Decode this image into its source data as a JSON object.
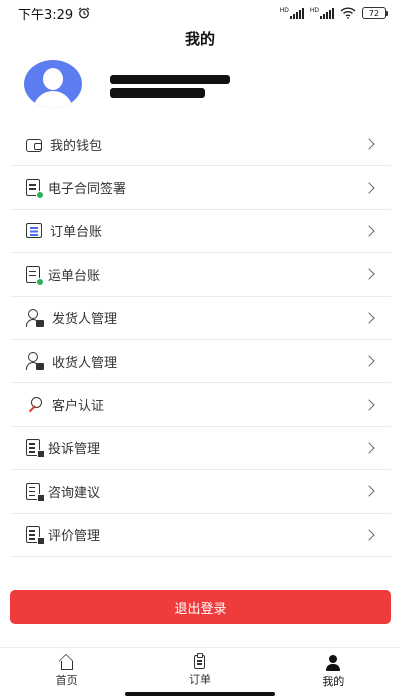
{
  "status_bar": {
    "time": "下午3:29",
    "battery": "72",
    "network_label": "HD"
  },
  "header": {
    "title": "我的"
  },
  "profile": {
    "name_redacted": true
  },
  "menu": {
    "items": [
      {
        "label": "我的钱包",
        "icon": "wallet-icon"
      },
      {
        "label": "电子合同签署",
        "icon": "contract-icon"
      },
      {
        "label": "订单台账",
        "icon": "order-ledger-icon"
      },
      {
        "label": "运单台账",
        "icon": "waybill-ledger-icon"
      },
      {
        "label": "发货人管理",
        "icon": "shipper-icon"
      },
      {
        "label": "收货人管理",
        "icon": "consignee-icon"
      },
      {
        "label": "客户认证",
        "icon": "certification-icon"
      },
      {
        "label": "投诉管理",
        "icon": "complaint-icon"
      },
      {
        "label": "咨询建议",
        "icon": "consult-icon"
      },
      {
        "label": "评价管理",
        "icon": "review-icon"
      }
    ]
  },
  "logout_label": "退出登录",
  "tabbar": {
    "tabs": [
      {
        "label": "首页",
        "icon": "home-icon"
      },
      {
        "label": "订单",
        "icon": "order-icon"
      },
      {
        "label": "我的",
        "icon": "profile-icon",
        "active": true
      }
    ]
  },
  "colors": {
    "accent_red": "#ef3b3b",
    "avatar_blue": "#5b7df0",
    "green_badge": "#2fae5a"
  }
}
